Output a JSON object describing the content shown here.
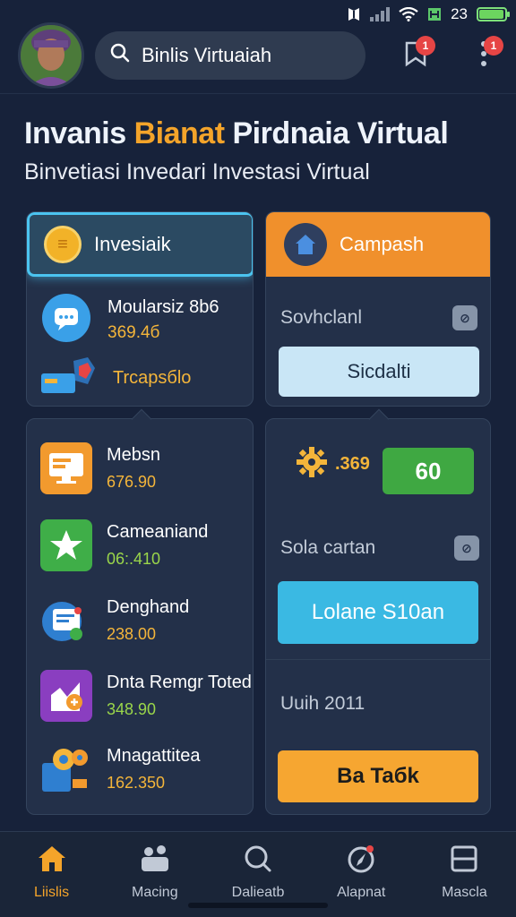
{
  "status_bar": {
    "time": "23",
    "battery_level": 0.95
  },
  "header": {
    "search_value": "Binlis Virtuaiah",
    "notification_badge": "1",
    "menu_badge": "1"
  },
  "headline": {
    "part1": "Invanis",
    "accent": "Bianat",
    "part2": "Pirdnaia Virtual",
    "subtitle": "Binvetiasi Invedari Investasi Virtual"
  },
  "invest_card": {
    "tab_label": "Invesiaik",
    "item1": {
      "label": "Moularsiz 8b6",
      "value": "369.4б"
    },
    "item2": {
      "label": "Trcapsбlo"
    }
  },
  "campaign_card": {
    "tab_label": "Campash",
    "text": "Sovhclanl",
    "button": "Sicdalti"
  },
  "list": [
    {
      "label": "Mebsn",
      "value": "676.90",
      "value_color": "#f4b53a",
      "icon": "monitor-icon"
    },
    {
      "label": "Cameaniand",
      "value": "06:.410",
      "value_color": "#9ad64a",
      "icon": "star-tile-icon"
    },
    {
      "label": "Denghand",
      "value": "238.00",
      "value_color": "#f4b53a",
      "icon": "document-icon"
    },
    {
      "label": "Dnta Remgr Toted",
      "value": "348.90",
      "value_color": "#9ad64a",
      "icon": "chart-up-icon"
    },
    {
      "label": "Mnagattitea",
      "value": "162.350",
      "value_color": "#f4b53a",
      "icon": "gears-icon"
    }
  ],
  "right_panel": {
    "score": ".369",
    "score_button": "60",
    "solar_text": "Sola cartan",
    "cyan_button": "Lolane S10an",
    "date_text": "Uuih 2011",
    "orange_button": "Ba Taбk"
  },
  "nav": [
    {
      "label": "Liislis",
      "icon": "home-icon",
      "active": true
    },
    {
      "label": "Macing",
      "icon": "group-icon",
      "active": false
    },
    {
      "label": "Dalieatb",
      "icon": "search-icon",
      "active": false
    },
    {
      "label": "Alapnat",
      "icon": "compass-icon",
      "active": false
    },
    {
      "label": "Mascla",
      "icon": "window-icon",
      "active": false
    }
  ],
  "colors": {
    "background": "#17223a",
    "accent_orange": "#f4a42a",
    "accent_cyan": "#4bc4f0",
    "success_green": "#3fa842"
  }
}
